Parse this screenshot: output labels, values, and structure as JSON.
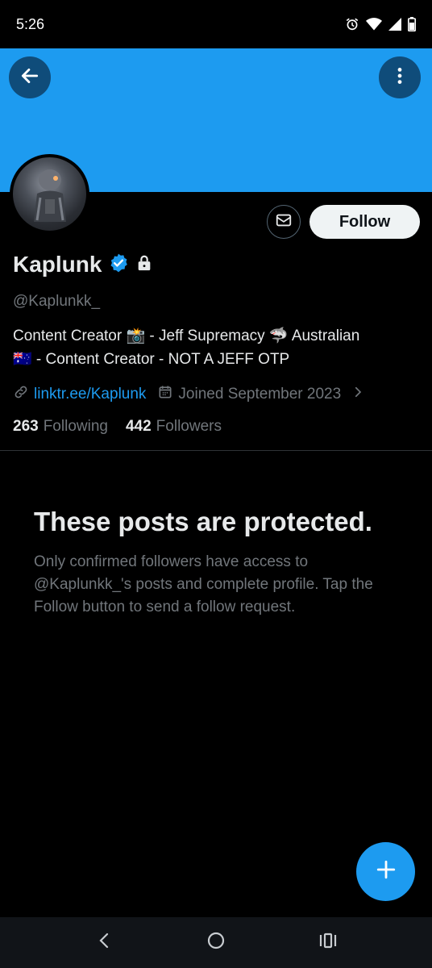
{
  "status_bar": {
    "time": "5:26",
    "icons": [
      "alarm-icon",
      "wifi-icon",
      "signal-icon",
      "battery-icon"
    ]
  },
  "colors": {
    "banner": "#1d9bf0",
    "accent": "#1d9bf0",
    "muted": "#71767b",
    "text": "#e7e9ea",
    "background": "#000000"
  },
  "header": {
    "back_icon": "arrow-left-icon",
    "more_icon": "more-vertical-icon"
  },
  "actions": {
    "message_icon": "envelope-icon",
    "follow_label": "Follow"
  },
  "profile": {
    "display_name": "Kaplunk",
    "verified_icon": "verified-badge-icon",
    "protected_icon": "lock-icon",
    "handle": "@Kaplunkk_",
    "bio_line1": "Content Creator 📸 - Jeff Supremacy 🦈 Australian",
    "bio_line2": "🇦🇺 - Content Creator  - NOT A JEFF OTP",
    "link": "linktr.ee/Kaplunk",
    "joined": "Joined September 2023",
    "following_count": "263",
    "following_label": "Following",
    "followers_count": "442",
    "followers_label": "Followers"
  },
  "protected_notice": {
    "title": "These posts are protected.",
    "text": "Only confirmed followers have access to @Kaplunkk_'s posts and complete profile. Tap the Follow button to send a follow request."
  },
  "fab": {
    "icon": "plus-icon"
  },
  "nav_bar": {
    "items": [
      "nav-back-icon",
      "nav-home-icon",
      "nav-recents-icon"
    ]
  }
}
